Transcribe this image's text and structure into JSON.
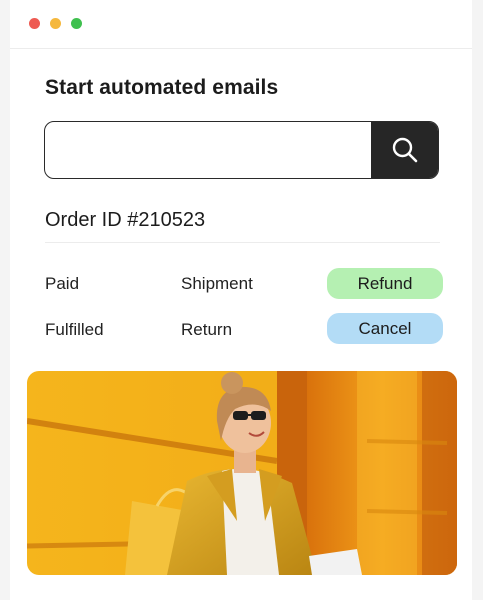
{
  "window": {
    "controls": [
      {
        "name": "close",
        "color": "#ee5a52"
      },
      {
        "name": "minimize",
        "color": "#f5b83d"
      },
      {
        "name": "maximize",
        "color": "#3fc04f"
      }
    ]
  },
  "heading": "Start automated emails",
  "search": {
    "value": "",
    "placeholder": "",
    "button_icon": "search-icon",
    "button_color": "#262626"
  },
  "order": {
    "title": "Order ID #210523",
    "statuses": {
      "row1": {
        "left": "Paid",
        "middle": "Shipment"
      },
      "row2": {
        "left": "Fulfilled",
        "middle": "Return"
      }
    },
    "actions": {
      "refund": {
        "label": "Refund",
        "color": "#b5f0b2"
      },
      "cancel": {
        "label": "Cancel",
        "color": "#b3dcf6"
      }
    }
  },
  "image": {
    "subject": "photo-woman-with-shopping-bags",
    "palette": [
      "#f3b21b",
      "#e5890d",
      "#c9600a",
      "#ffffff"
    ]
  }
}
